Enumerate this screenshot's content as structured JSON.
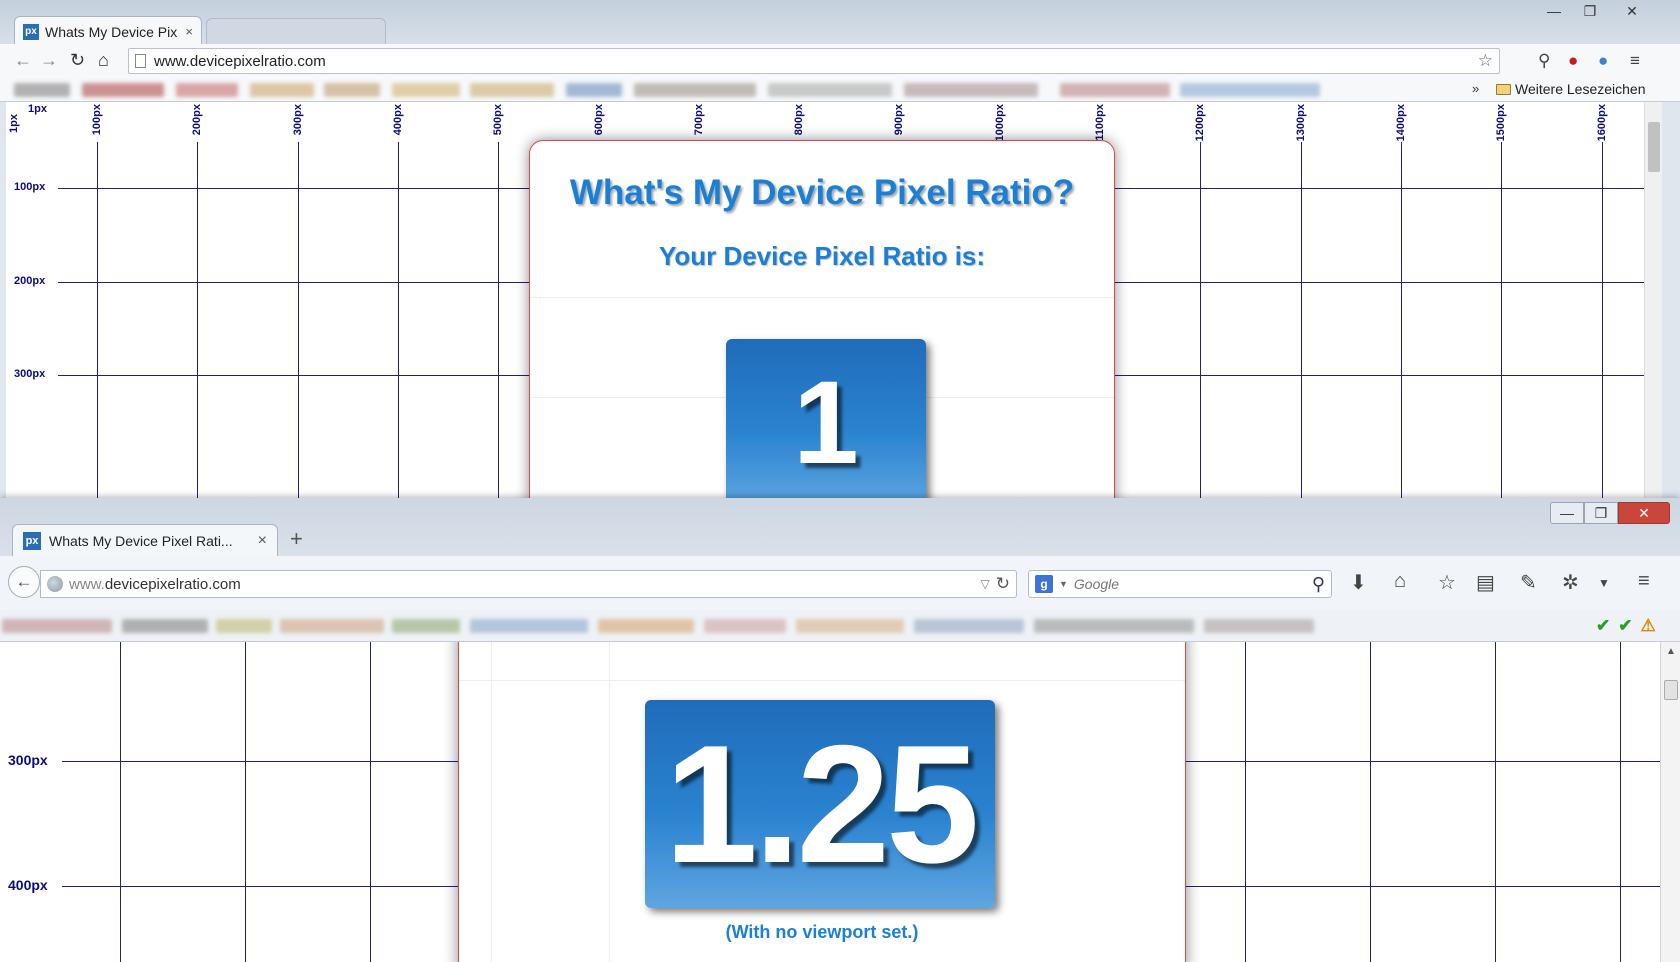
{
  "chrome": {
    "tab_title": "Whats My Device Pix",
    "tab_close": "×",
    "win_minimize": "—",
    "win_maximize": "❐",
    "win_close": "✕",
    "url": "www.devicepixelratio.com",
    "bookmarks_more": "»",
    "bookmarks_folder": "Weitere Lesezeichen"
  },
  "firefox": {
    "tab_title": "Whats My Device Pixel Rati...",
    "tab_close": "×",
    "new_tab": "+",
    "win_minimize": "—",
    "win_maximize": "❐",
    "win_close": "✕",
    "url_prefix": "www.",
    "url_domain": "devicepixelratio.com",
    "search_engine": "g",
    "search_placeholder": "Google"
  },
  "page_top": {
    "title": "What's My Device Pixel Ratio?",
    "subtitle": "Your Device Pixel Ratio is:",
    "ratio": "1",
    "ruler_corner": "1px",
    "ruler_origin": "1px",
    "x_ticks": [
      "100px",
      "200px",
      "300px",
      "400px",
      "500px",
      "600px",
      "700px",
      "800px",
      "900px",
      "1000px",
      "1100px",
      "1200px",
      "1300px",
      "1400px",
      "1500px",
      "1600px"
    ],
    "y_ticks": [
      "100px",
      "200px",
      "300px"
    ]
  },
  "page_bottom": {
    "ratio": "1.25",
    "note": "(With no viewport set.)",
    "y_ticks": [
      "300px",
      "400px"
    ]
  },
  "colors": {
    "accent_blue": "#1c7fd6",
    "grid_line": "#22226e",
    "card_border": "#d54a4a"
  }
}
